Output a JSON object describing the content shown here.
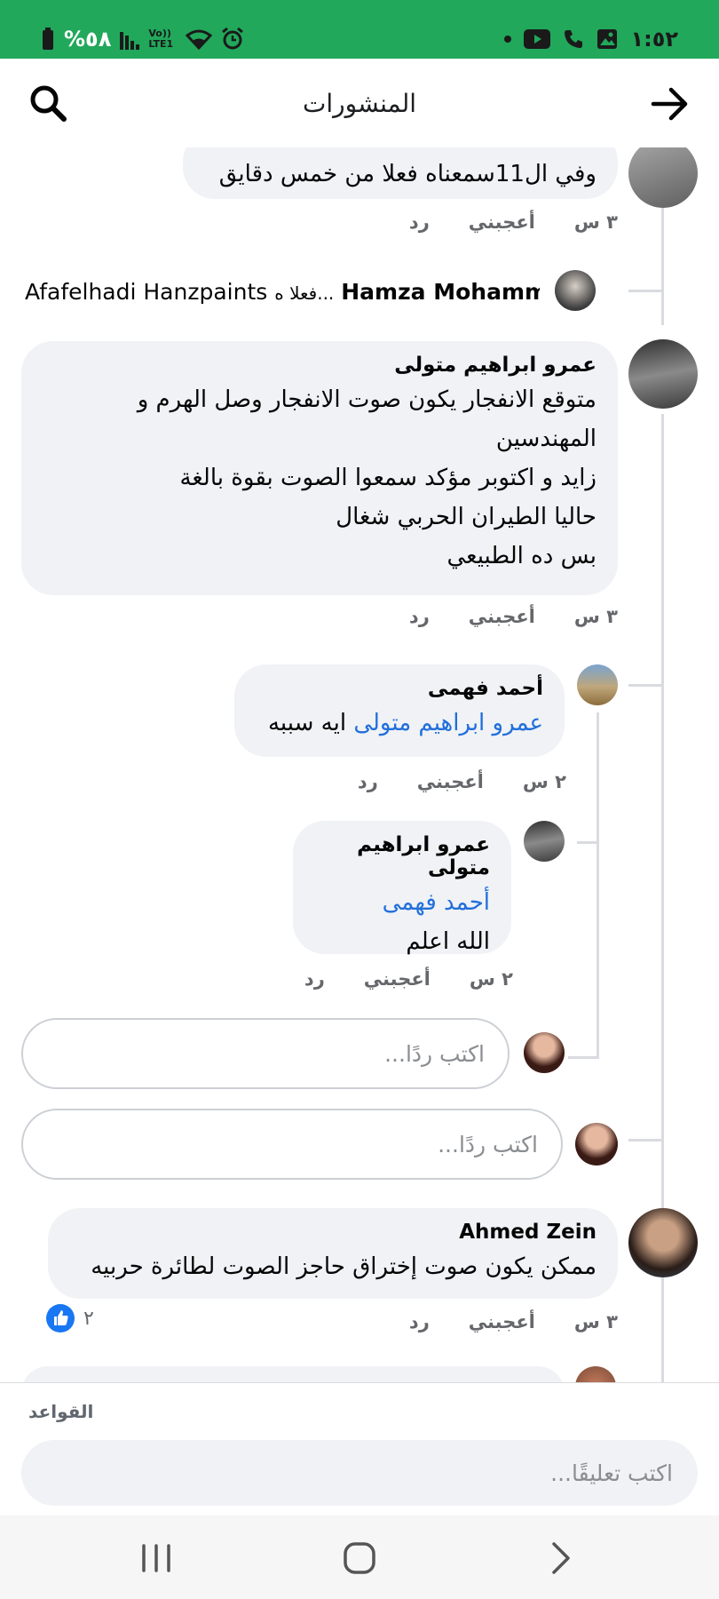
{
  "status_bar": {
    "battery_text": "%٥٨",
    "volte_text": "Vo)) LTE1",
    "time": "١:٥٢"
  },
  "header": {
    "title": "المنشورات",
    "back_icon": "arrow-right-icon",
    "search_icon": "search-icon"
  },
  "comments": {
    "partial": {
      "text": "وفي ال11سمعناه فعلا من خمس دقايق",
      "time": "٣ س",
      "like": "أعجبني",
      "reply": "رد"
    },
    "reply_summary": {
      "name": "Hamza Mohammad",
      "snippet": "فعلا ه...",
      "others": "Afafelhadi Hanzpaints"
    },
    "amr": {
      "name": "عمرو ابراهيم متولى",
      "lines": [
        "متوقع الانفجار يكون صوت الانفجار وصل الهرم و",
        "المهندسين",
        "زايد و اكتوبر مؤكد سمعوا الصوت بقوة بالغة",
        "حاليا الطيران الحربي شغال",
        "بس ده الطبيعي"
      ],
      "time": "٣ س",
      "like": "أعجبني",
      "reply": "رد"
    },
    "ahmed_fahmy": {
      "name": "أحمد فهمى",
      "mention": "عمرو ابراهيم متولى",
      "text": " ايه سببه",
      "time": "٢ س",
      "like": "أعجبني",
      "reply": "رد"
    },
    "amr_reply": {
      "name": "عمرو ابراهيم متولى",
      "mention": "أحمد فهمى",
      "text": "الله اعلم",
      "time": "٢ س",
      "like": "أعجبني",
      "reply": "رد"
    },
    "reply_placeholder_1": "اكتب ردًا...",
    "reply_placeholder_2": "اكتب ردًا...",
    "ahmed_zein": {
      "name": "Ahmed Zein",
      "text": "ممكن يكون صوت إختراق حاجز الصوت لطائرة حربيه",
      "time": "٣ س",
      "like": "أعجبني",
      "reply": "رد",
      "reaction_count": "٢"
    }
  },
  "composer": {
    "rules": "القواعد",
    "placeholder": "اكتب تعليقًا..."
  },
  "colors": {
    "status_bar": "#21a85b",
    "bubble": "#f0f2f5",
    "mention": "#216fdb",
    "like_blue": "#1877f2"
  }
}
